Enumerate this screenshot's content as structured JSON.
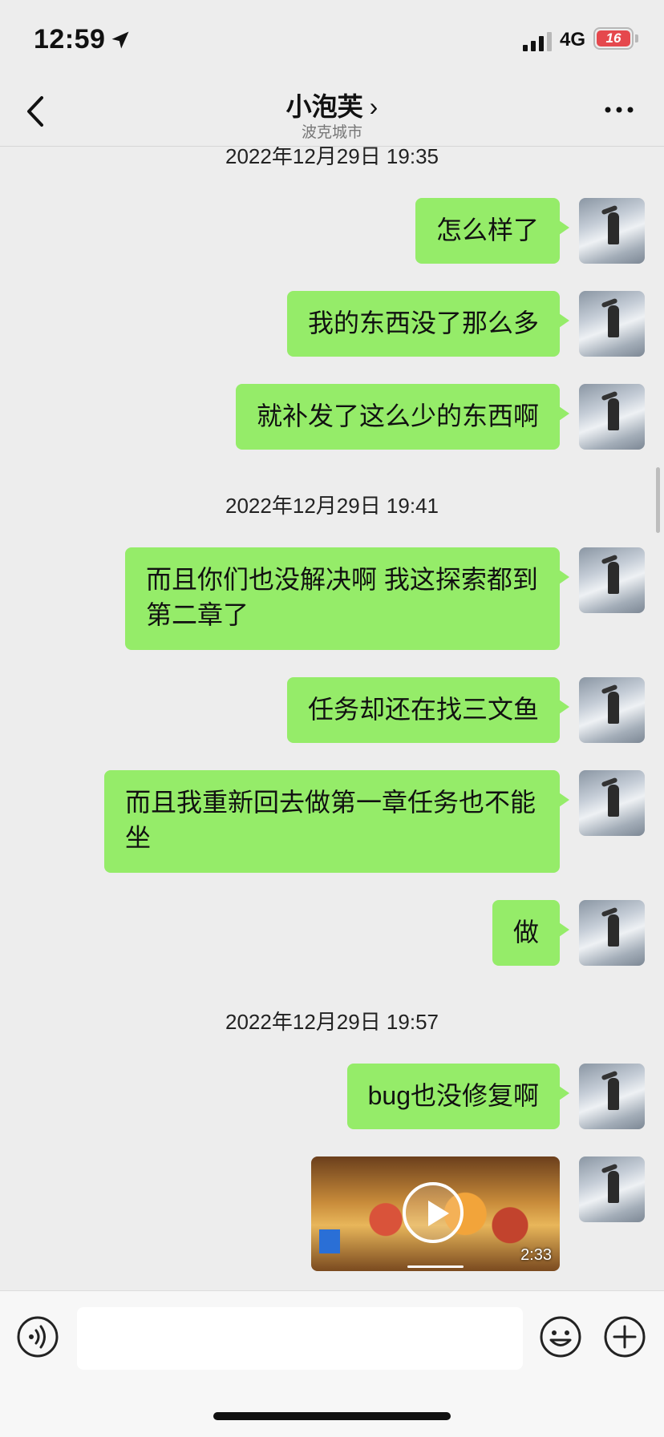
{
  "status": {
    "time": "12:59",
    "network": "4G",
    "battery": "16"
  },
  "nav": {
    "title": "小泡芙",
    "chevron": "›",
    "subtitle": "波克城市"
  },
  "chat": {
    "timestamps": [
      "2022年12月29日 19:35",
      "2022年12月29日 19:41",
      "2022年12月29日 19:57"
    ],
    "messages": [
      {
        "text": "怎么样了"
      },
      {
        "text": "我的东西没了那么多"
      },
      {
        "text": "就补发了这么少的东西啊"
      },
      {
        "text": "而且你们也没解决啊 我这探索都到第二章了"
      },
      {
        "text": "任务却还在找三文鱼"
      },
      {
        "text": "而且我重新回去做第一章任务也不能坐"
      },
      {
        "text": "做"
      },
      {
        "text": "bug也没修复啊"
      }
    ],
    "video": {
      "duration": "2:33"
    }
  },
  "input": {
    "placeholder": ""
  },
  "colors": {
    "bubble": "#95ec69",
    "background": "#ededed"
  },
  "icons": [
    "location-arrow-icon",
    "signal-icon",
    "battery-icon",
    "back-chevron-icon",
    "more-icon",
    "voice-icon",
    "emoji-icon",
    "plus-icon",
    "play-icon"
  ]
}
